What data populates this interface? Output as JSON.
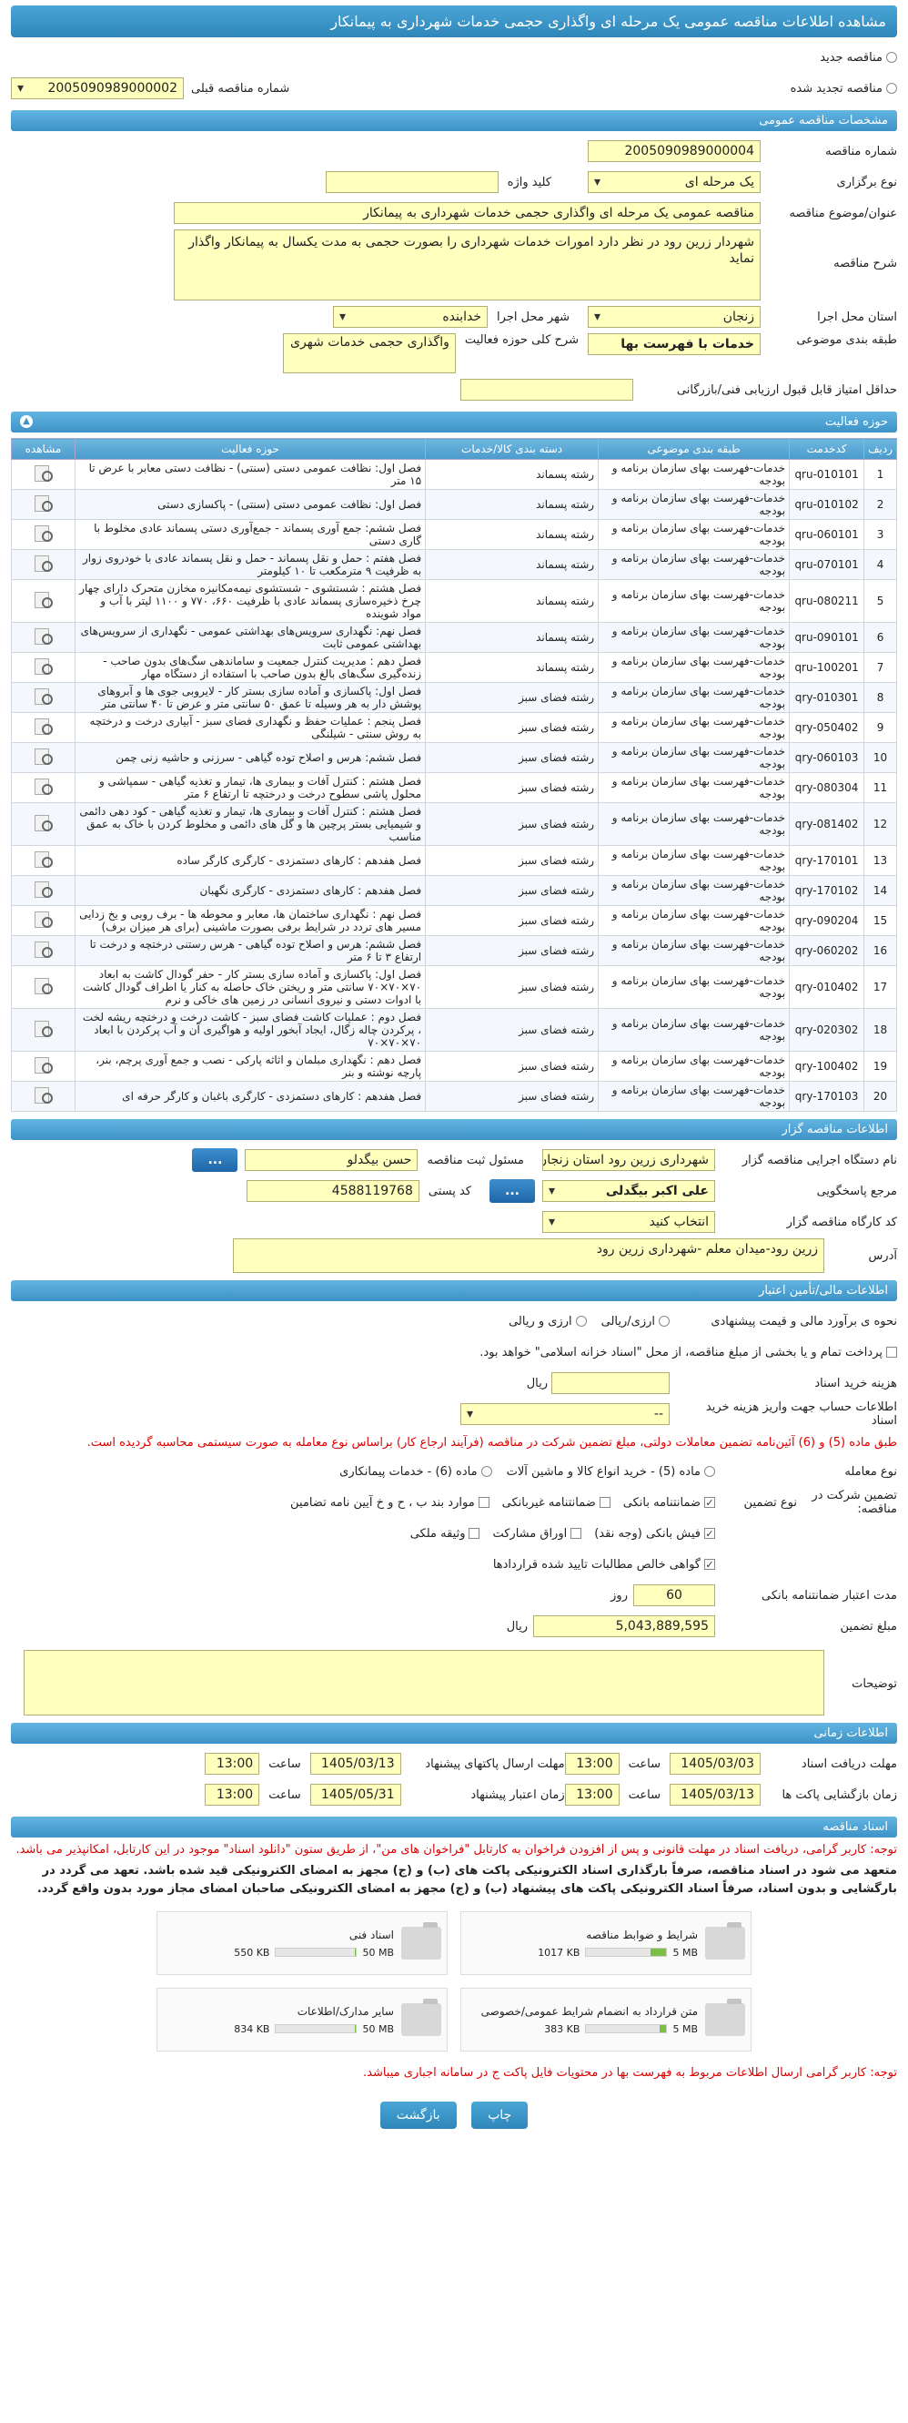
{
  "title": "مشاهده اطلاعات مناقصه عمومی یک مرحله ای واگذاری حجمی خدمات شهرداری به پیمانکار",
  "top": {
    "new_label": "مناقصه جدید",
    "renewed_label": "مناقصه تجدید شده",
    "previous_number_label": "شماره مناقصه قبلی",
    "previous_number": "2005090989000002"
  },
  "general": {
    "header": "مشخصات مناقصه عمومی",
    "number_label": "شماره مناقصه",
    "number": "2005090989000004",
    "type_label": "نوع برگزاری",
    "type": "یک مرحله ای",
    "keyword_label": "کلید واژه",
    "subject_label": "عنوان/موضوع مناقصه",
    "subject": "مناقصه عمومی یک مرحله ای واگذاری حجمی خدمات شهرداری به پیمانکار",
    "desc_label": "شرح مناقصه",
    "desc": "شهردار زرین رود در نظر دارد امورات خدمات شهرداری را بصورت حجمی به مدت یکسال به پیمانکار واگذار نماید",
    "province_label": "استان محل اجرا",
    "province": "زنجان",
    "city_label": "شهر محل اجرا",
    "city": "خدابنده",
    "category_label": "طبقه بندی موضوعی",
    "category": "خدمات با فهرست بها",
    "scope_label": "شرح کلی حوزه فعالیت",
    "scope": "واگذاری حجمی خدمات شهری",
    "min_score_label": "حداقل امتیاز قابل قبول ارزیابی فنی/بازرگانی"
  },
  "activities": {
    "header": "حوزه فعالیت",
    "columns": [
      "ردیف",
      "کدخدمت",
      "طبقه بندی موضوعی",
      "دسته بندی کالا/خدمات",
      "حوزه فعالیت",
      "مشاهده"
    ],
    "rows": [
      [
        "1",
        "qru-010101",
        "خدمات-فهرست بهای سازمان برنامه و بودجه",
        "رشته پسماند",
        "فصل اول: نظافت عمومی دستی (سنتی) - نظافت دستی معابر با عرض تا ۱۵ متر"
      ],
      [
        "2",
        "qru-010102",
        "خدمات-فهرست بهای سازمان برنامه و بودجه",
        "رشته پسماند",
        "فصل اول: نظافت عمومی دستی (سنتی) - پاکسازی دستی"
      ],
      [
        "3",
        "qru-060101",
        "خدمات-فهرست بهای سازمان برنامه و بودجه",
        "رشته پسماند",
        "فصل ششم: جمع آوری پسماند - جمع‌آوری دستی پسماند عادی مخلوط با گاری دستی"
      ],
      [
        "4",
        "qru-070101",
        "خدمات-فهرست بهای سازمان برنامه و بودجه",
        "رشته پسماند",
        "فصل هفتم : حمل و نقل پسماند - حمل و نقل پسماند عادی با خودروی زوار به ظرفیت ۹ مترمکعب تا ۱۰ کیلومتر"
      ],
      [
        "5",
        "qru-080211",
        "خدمات-فهرست بهای سازمان برنامه و بودجه",
        "رشته پسماند",
        "فصل هشتم : شستشوی - شستشوی نیمه‌مکانیزه مخازن متحرک دارای چهار چرخ ذخیره‌سازی پسماند عادی با ظرفیت ۶۶۰، ۷۷۰ و ۱۱۰۰ لیتر با آب و مواد شوینده"
      ],
      [
        "6",
        "qru-090101",
        "خدمات-فهرست بهای سازمان برنامه و بودجه",
        "رشته پسماند",
        "فصل نهم: نگهداری سرویس‌های بهداشتی عمومی - نگهداری از سرویس‌های بهداشتی عمومی ثابت"
      ],
      [
        "7",
        "qru-100201",
        "خدمات-فهرست بهای سازمان برنامه و بودجه",
        "رشته پسماند",
        "فصل دهم : مدیریت کنترل جمعیت و ساماندهی سگ‌های بدون صاحب - زنده‌گیری سگ‌های بالغ بدون صاحب با استفاده از دستگاه مهار"
      ],
      [
        "8",
        "qry-010301",
        "خدمات-فهرست بهای سازمان برنامه و بودجه",
        "رشته فضای سبز",
        "فصل اول: پاکسازی و آماده سازی بستر کار - لایروبی جوی ها و آبروهای پوشش دار به هر وسیله تا عمق ۵۰ سانتی متر و عرض تا ۴۰ سانتی متر"
      ],
      [
        "9",
        "qry-050402",
        "خدمات-فهرست بهای سازمان برنامه و بودجه",
        "رشته فضای سبز",
        "فصل پنجم : عملیات حفظ و نگهداری فضای سبز - آبیاری درخت و درختچه به روش سنتی - شیلنگی"
      ],
      [
        "10",
        "qry-060103",
        "خدمات-فهرست بهای سازمان برنامه و بودجه",
        "رشته فضای سبز",
        "فصل ششم: هرس و اصلاح توده گیاهی - سرزنی و حاشیه زنی چمن"
      ],
      [
        "11",
        "qry-080304",
        "خدمات-فهرست بهای سازمان برنامه و بودجه",
        "رشته فضای سبز",
        "فصل هشتم : کنترل آفات و بیماری ها، تیمار و تغذیه گیاهی - سمپاشی و محلول پاشی سطوح درخت و درختچه تا ارتفاع ۶ متر"
      ],
      [
        "12",
        "qry-081402",
        "خدمات-فهرست بهای سازمان برنامه و بودجه",
        "رشته فضای سبز",
        "فصل هشتم : کنترل آفات و بیماری ها، تیمار و تغذیه گیاهی - کود دهی دائمی و شیمیایی بستر پرچین ها و گل های دائمی و مخلوط کردن با خاک به عمق مناسب"
      ],
      [
        "13",
        "qry-170101",
        "خدمات-فهرست بهای سازمان برنامه و بودجه",
        "رشته فضای سبز",
        "فصل هفدهم : کارهای دستمزدی - کارگری کارگر ساده"
      ],
      [
        "14",
        "qry-170102",
        "خدمات-فهرست بهای سازمان برنامه و بودجه",
        "رشته فضای سبز",
        "فصل هفدهم : کارهای دستمزدی - کارگری نگهبان"
      ],
      [
        "15",
        "qry-090204",
        "خدمات-فهرست بهای سازمان برنامه و بودجه",
        "رشته فضای سبز",
        "فصل نهم : نگهداری ساختمان ها، معابر و محوطه ها - برف روبی و یخ زدایی مسیر های تردد در شرایط برفی بصورت ماشینی (برای هر میزان برف)"
      ],
      [
        "16",
        "qry-060202",
        "خدمات-فهرست بهای سازمان برنامه و بودجه",
        "رشته فضای سبز",
        "فصل ششم: هرس و اصلاح توده گیاهی - هرس رستنی درختچه و درخت تا ارتفاع ۳ تا ۶ متر"
      ],
      [
        "17",
        "qry-010402",
        "خدمات-فهرست بهای سازمان برنامه و بودجه",
        "رشته فضای سبز",
        "فصل اول: پاکسازی و آماده سازی بستر کار - حفر گودال کاشت به ابعاد ۷۰×۷۰×۷۰ سانتی متر و ریختن خاک حاصله به کنار یا اطراف گودال کاشت با ادوات دستی و نیروی انسانی در زمین های خاکی و نرم"
      ],
      [
        "18",
        "qry-020302",
        "خدمات-فهرست بهای سازمان برنامه و بودجه",
        "رشته فضای سبز",
        "فصل دوم : عملیات کاشت فضای سبز - کاشت درخت و درختچه ریشه لخت ، پرکردن چاله زگال، ایجاد آبخور اولیه و هواگیری آن و آب پرکردن با ابعاد ۷۰×۷۰×۷۰"
      ],
      [
        "19",
        "qry-100402",
        "خدمات-فهرست بهای سازمان برنامه و بودجه",
        "رشته فضای سبز",
        "فصل دهم : نگهداری مبلمان و اثاثه پارکی - نصب و جمع آوری پرچم، بنر، پارچه نوشته و بنر"
      ],
      [
        "20",
        "qry-170103",
        "خدمات-فهرست بهای سازمان برنامه و بودجه",
        "رشته فضای سبز",
        "فصل هفدهم : کارهای دستمزدی - کارگری باغبان و کارگر حرفه ای"
      ]
    ]
  },
  "organizer": {
    "header": "اطلاعات مناقصه گزار",
    "org_label": "نام دستگاه اجرایی مناقصه گزار",
    "org": "شهرداری زرین رود استان زنجان",
    "officer_label": "مسئول ثبت مناقصه",
    "officer": "حسن  بیگدلو",
    "responder_label": "مرجع پاسخگویی",
    "responder": "علی اکبر بیگدلی",
    "postal_label": "کد پستی",
    "postal": "4588119768",
    "workshop_label": "کد کارگاه مناقصه گزار",
    "workshop": "انتخاب کنید",
    "address_label": "آدرس",
    "address": "زرین رود-میدان معلم -شهرداری زرین رود",
    "more_button": "..."
  },
  "finance": {
    "header": "اطلاعات مالی/تأمین اعتبار",
    "method_label": "نحوه ی برآورد مالی و قیمت پیشنهادی",
    "method_rial": "ارزی/ریالی",
    "method_fx": "ارزی و ریالی",
    "treasury_text": "پرداخت تمام و یا بخشی از مبلغ مناقصه، از محل \"اسناد خزانه اسلامی\" خواهد بود.",
    "doc_cost_label": "هزینه خرید اسناد",
    "doc_cost_unit": "ریال",
    "account_label": "اطلاعات حساب جهت واریز هزینه خرید اسناد",
    "account_value": "--"
  },
  "guarantee": {
    "warning": "طبق ماده (5) و (6) آئین‌نامه تضمین معاملات دولتی، مبلغ تضمین شرکت در مناقصه (فرآیند ارجاع کار) براساس نوع معامله به صورت سیستمی محاسبه گردیده است.",
    "deal_type_label": "نوع معامله",
    "opt_1": "ماده (5) - خرید انواع کالا و ماشین آلات",
    "opt_2": "ماده (6) - خدمات پیمانکاری",
    "types_label": "تضمین شرکت در مناقصه:",
    "type_kind_label": "نوع تضمین",
    "c1": "ضمانتنامه بانکی",
    "c2": "ضمانتنامه غیربانکی",
    "c3": "موارد بند ب ، ح و خ آیین نامه تضامین",
    "c4": "فیش بانکی (وجه نقد)",
    "c5": "اوراق مشارکت",
    "c6": "وثیقه ملکی",
    "c7": "گواهی خالص مطالبات تایید شده قراردادها",
    "validity_label": "مدت اعتبار ضمانتنامه بانکی",
    "validity": "60",
    "validity_unit": "روز",
    "amount_label": "مبلغ تضمین",
    "amount": "5,043,889,595",
    "amount_unit": "ریال",
    "notes_label": "توضیحات"
  },
  "timing": {
    "header": "اطلاعات زمانی",
    "doc_receive_label": "مهلت دریافت اسناد",
    "doc_receive_date": "1405/03/03",
    "doc_receive_time": "13:00",
    "offer_send_label": "مهلت ارسال پاکتهای پیشنهاد",
    "offer_send_date": "1405/03/13",
    "offer_send_time": "13:00",
    "opening_label": "زمان بازگشایی پاکت ها",
    "opening_date": "1405/03/13",
    "opening_time": "13:00",
    "validity_label": "زمان اعتبار پیشنهاد",
    "validity_date": "1405/05/31",
    "validity_time": "13:00",
    "time_label": "ساعت"
  },
  "documents": {
    "header": "اسناد مناقصه",
    "note1": "توجه: کاربر گرامی، دریافت اسناد در مهلت قانونی و پس از افزودن فراخوان به کارتابل \"فراخوان های من\"، از طریق ستون \"دانلود اسناد\" موجود در این کارتابل، امکانپذیر می باشد.",
    "note2": "متعهد می شود در اسناد مناقصه، صرفاً بارگذاری اسناد الکترونیکی پاکت های (ب) و (ج) مجهز به امضای الکترونیکی قید شده باشد. تعهد می گردد در بارگشایی و بدون اسناد، صرفاً اسناد الکترونیکی پاکت های پیشنهاد (ب) و (ج) مجهز به امضای الکترونیکی صاحبان امضای مجاز مورد بدون واقع گردد.",
    "cards": [
      {
        "title": "شرایط و ضوابط مناقصه",
        "used": "1017 KB",
        "max": "5 MB",
        "fill": 0.2
      },
      {
        "title": "اسناد فنی",
        "used": "550 KB",
        "max": "50 MB",
        "fill": 0.01
      },
      {
        "title": "متن قرارداد به انضمام شرایط عمومی/خصوصی",
        "used": "383 KB",
        "max": "5 MB",
        "fill": 0.08
      },
      {
        "title": "سایر مدارک/اطلاعات",
        "used": "834 KB",
        "max": "50 MB",
        "fill": 0.02
      }
    ],
    "note3": "توجه: کاربر گرامی ارسال اطلاعات مربوط به فهرست بها در محتویات فایل پاکت ج در سامانه اجباری میباشد."
  },
  "buttons": {
    "print": "چاپ",
    "back": "بازگشت"
  }
}
